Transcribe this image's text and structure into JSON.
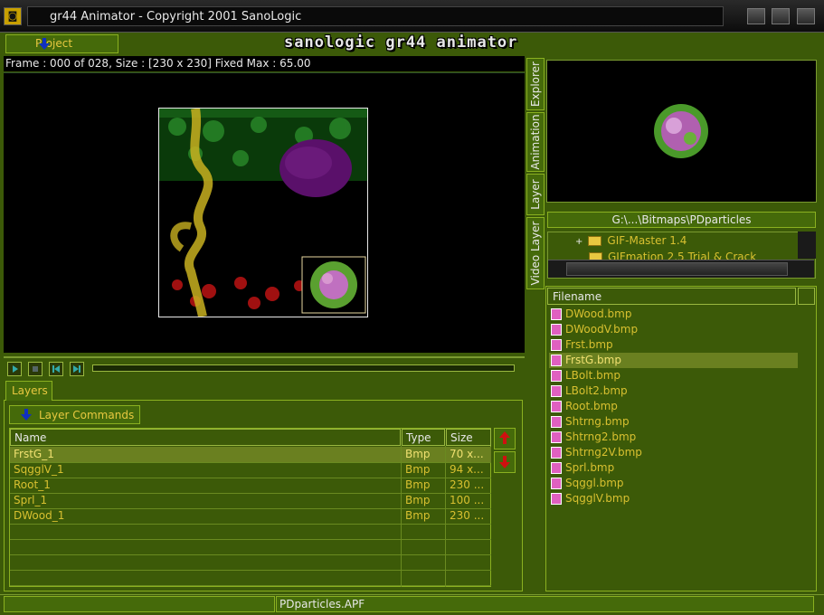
{
  "window": {
    "title": "gr44 Animator - Copyright 2001 SanoLogic"
  },
  "toolbar": {
    "project_label": "Project",
    "brand": "sanologic gr44 animator"
  },
  "viewer": {
    "frame_info": "Frame : 000 of 028,  Size : [230 x 230] Fixed  Max : 65.00"
  },
  "layers": {
    "tab_label": "Layers",
    "commands_label": "Layer Commands",
    "columns": [
      "Name",
      "Type",
      "Size"
    ],
    "rows": [
      {
        "name": "FrstG_1",
        "type": "Bmp",
        "size": "70 x..."
      },
      {
        "name": "SqgglV_1",
        "type": "Bmp",
        "size": "94 x..."
      },
      {
        "name": "Root_1",
        "type": "Bmp",
        "size": "230 ..."
      },
      {
        "name": "Sprl_1",
        "type": "Bmp",
        "size": "100 ..."
      },
      {
        "name": "DWood_1",
        "type": "Bmp",
        "size": "230 ..."
      }
    ]
  },
  "side_tabs": [
    "Explorer",
    "Animation",
    "Layer",
    "Video Layer"
  ],
  "explorer": {
    "path": "G:\\...\\Bitmaps\\PDparticles",
    "folders": [
      "GIF-Master 1.4",
      "GIFmation 2.5 Trial & Crack"
    ],
    "filename_header": "Filename",
    "files": [
      "DWood.bmp",
      "DWoodV.bmp",
      "Frst.bmp",
      "FrstG.bmp",
      "LBolt.bmp",
      "LBolt2.bmp",
      "Root.bmp",
      "Shtrng.bmp",
      "Shtrng2.bmp",
      "Shtrng2V.bmp",
      "Sprl.bmp",
      "Sqggl.bmp",
      "SqgglV.bmp"
    ],
    "selected_file": "FrstG.bmp"
  },
  "status": {
    "project_file": "PDparticles.APF"
  },
  "colors": {
    "panel": "#3c5a08",
    "text": "#d8c030",
    "border": "#8ab020",
    "selection": "#6a8020"
  }
}
